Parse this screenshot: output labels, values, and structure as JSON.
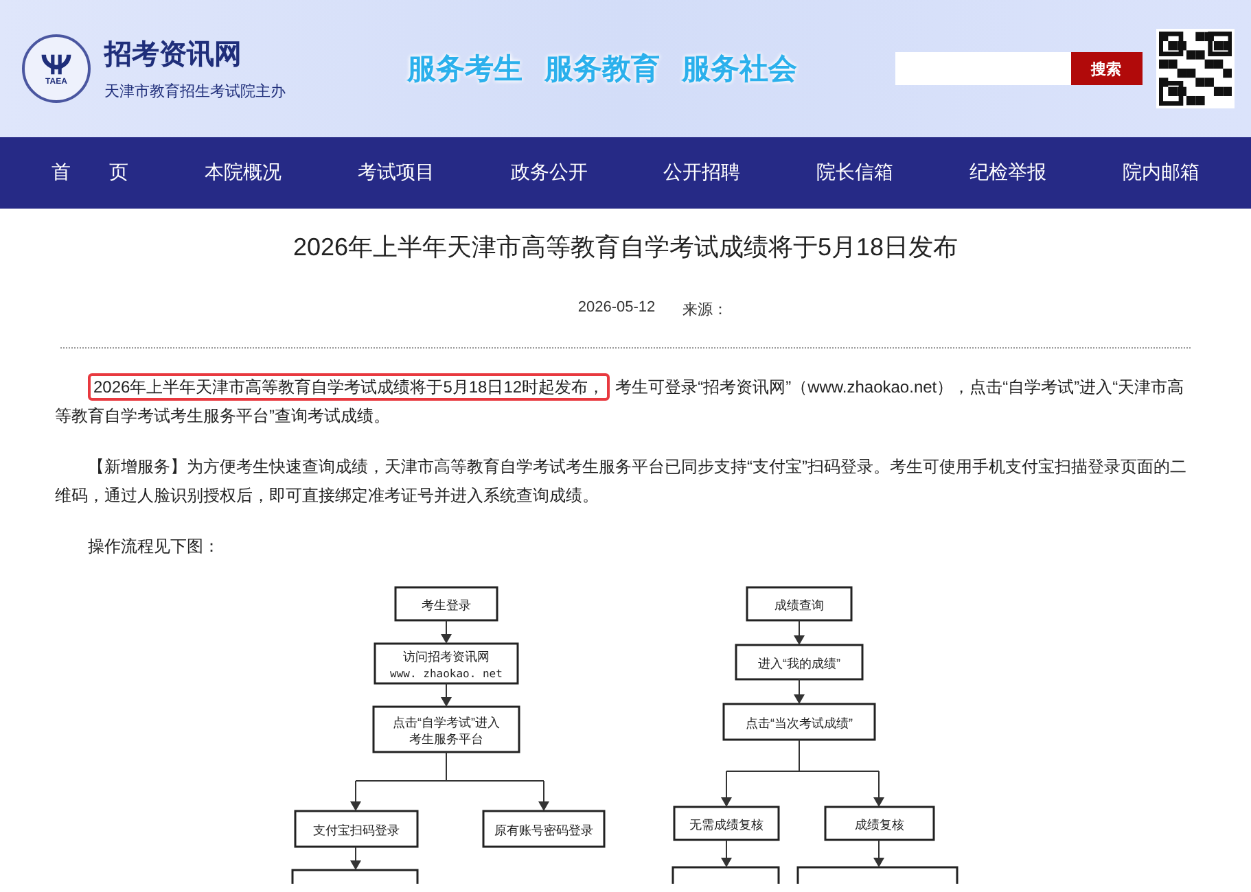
{
  "header": {
    "logo_badge": "TAEA",
    "site_name": "招考资讯网",
    "sponsor": "天津市教育招生考试院主办",
    "slogans": [
      "服务考生",
      "服务教育",
      "服务社会"
    ],
    "search": {
      "button": "搜索"
    }
  },
  "nav": [
    {
      "label": "首　　页"
    },
    {
      "label": "本院概况"
    },
    {
      "label": "考试项目"
    },
    {
      "label": "政务公开"
    },
    {
      "label": "公开招聘"
    },
    {
      "label": "院长信箱"
    },
    {
      "label": "纪检举报"
    },
    {
      "label": "院内邮箱"
    }
  ],
  "article": {
    "title": "2026年上半年天津市高等教育自学考试成绩将于5月18日发布",
    "date": "2026-05-12",
    "source_label": "来源：",
    "paragraphs": [
      {
        "highlight": "2026年上半年天津市高等教育自学考试成绩将于5月18日12时起发布，",
        "text": "考生可登录“招考资讯网”（www.zhaokao.net），点击“自学考试”进入“天津市高等教育自学考试考生服务平台”查询考试成绩。"
      },
      {
        "text": "【新增服务】为方便考生快速查询成绩，天津市高等教育自学考试考生服务平台已同步支持“支付宝”扫码登录。考生可使用手机支付宝扫描登录页面的二维码，通过人脸识别授权后，即可直接绑定准考证号并进入系统查询成绩。"
      },
      {
        "text": "操作流程见下图："
      }
    ],
    "flowchart": {
      "nodes": [
        {
          "lines": [
            "考生登录"
          ]
        },
        {
          "lines": [
            "访问招考资讯网",
            "www. zhaokao. net"
          ]
        },
        {
          "lines": [
            "点击“自学考试”进入",
            "考生服务平台"
          ]
        },
        {
          "lines": [
            "支付宝扫码登录"
          ]
        },
        {
          "lines": [
            "原有账号密码登录"
          ]
        },
        {
          "lines": [
            "成绩查询"
          ]
        },
        {
          "lines": [
            "进入“我的成绩”"
          ]
        },
        {
          "lines": [
            "点击“当次考试成绩”"
          ]
        },
        {
          "lines": [
            "无需成绩复核"
          ]
        },
        {
          "lines": [
            "成绩复核"
          ]
        }
      ]
    }
  }
}
